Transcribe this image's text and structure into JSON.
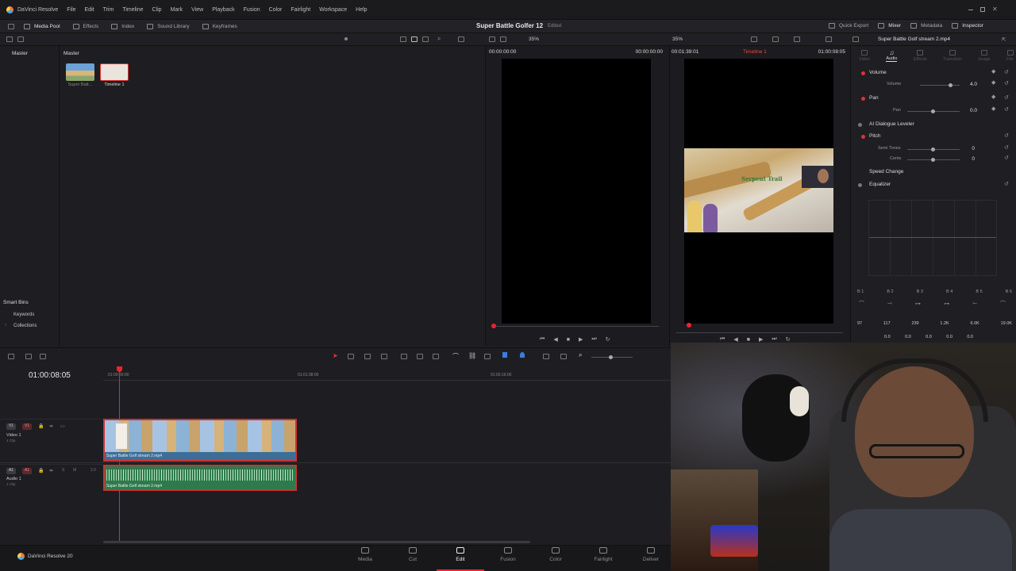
{
  "app": {
    "name": "DaVinci Resolve",
    "project_title": "Super Battle Golfer 12",
    "edited_status": "Edited",
    "version_label": "DaVinci Resolve 20"
  },
  "menu": [
    "File",
    "Edit",
    "Trim",
    "Timeline",
    "Clip",
    "Mark",
    "View",
    "Playback",
    "Fusion",
    "Color",
    "Fairlight",
    "Workspace",
    "Help"
  ],
  "toolbar_left": [
    "Media Pool",
    "Effects",
    "Index",
    "Sound Library",
    "Keyframes"
  ],
  "toolbar_right": [
    "Quick Export",
    "Mixer",
    "Metadata",
    "Inspector"
  ],
  "viewer": {
    "source_zoom": "35%",
    "timeline_zoom": "35%",
    "source_tc_in": "00:00:00:00",
    "source_tc_out": "00:00:00:00",
    "timeline_duration": "00:01:39:01",
    "timeline_name": "Timeline 1",
    "timeline_tc": "01:00:08:05",
    "game_text": "Serpent Trail"
  },
  "media_pool": {
    "bin_root": "Master",
    "current_bin": "Master",
    "clips": [
      {
        "name": "Super Batt..."
      },
      {
        "name": "Timeline 1"
      }
    ],
    "smart_bins": "Smart Bins",
    "smart_bin_items": [
      "Keywords",
      "Collections"
    ]
  },
  "inspector": {
    "clip_name": "Super Battle Golf stream 2.mp4",
    "tabs": [
      "Video",
      "Audio",
      "Effects",
      "Transition",
      "Image",
      "File"
    ],
    "volume_section": "Volume",
    "volume_label": "Volume",
    "volume_value": "4.0",
    "pan_section": "Pan",
    "pan_label": "Pan",
    "pan_value": "0.0",
    "dialogue_leveler": "AI Dialogue Leveler",
    "pitch_section": "Pitch",
    "semitones_label": "Semi Tones",
    "semitones_value": "0",
    "cents_label": "Cents",
    "cents_value": "0",
    "speed_change": "Speed Change",
    "equalizer": "Equalizer",
    "eq_bands": [
      "B 1",
      "B 2",
      "B 3",
      "B 4",
      "B 5",
      "B 6"
    ],
    "eq_freqs": [
      "97",
      "117",
      "239",
      "1.2K",
      "6.0K",
      "19.0K"
    ],
    "eq_gains": [
      "0.0",
      "0.0",
      "0.0",
      "0.0",
      "0.0"
    ]
  },
  "timeline": {
    "current_tc": "01:00:08:05",
    "ruler": [
      "01:00:00:00",
      "01:01:38:00",
      "01:03:16:00"
    ],
    "tracks": {
      "video": {
        "id": "V1",
        "name": "Video 1",
        "clips": "1 Clip",
        "clip_label": "Super Battle Golf stream 2.mp4"
      },
      "audio": {
        "id": "A1",
        "name": "Audio 1",
        "clips": "1 Clip",
        "channel": "2.0",
        "clip_label": "Super Battle Golf stream 2.mp4"
      }
    }
  },
  "pages": [
    "Media",
    "Cut",
    "Edit",
    "Fusion",
    "Color",
    "Fairlight",
    "Deliver"
  ],
  "active_page": "Edit"
}
